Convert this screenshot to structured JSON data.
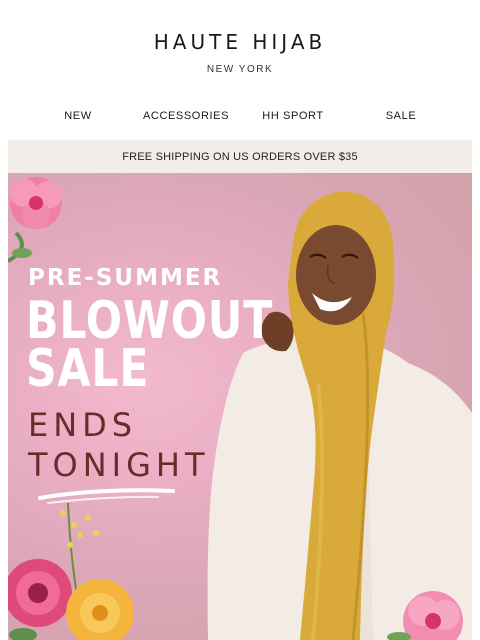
{
  "brand": {
    "name": "HAUTE HIJAB",
    "subtitle": "NEW YORK"
  },
  "nav": {
    "items": [
      {
        "label": "NEW"
      },
      {
        "label": "ACCESSORIES"
      },
      {
        "label": "HH SPORT"
      },
      {
        "label": "SALE"
      }
    ]
  },
  "banner": {
    "shipping": "FREE SHIPPING ON US ORDERS OVER $35"
  },
  "hero": {
    "pre": "PRE-SUMMER",
    "line1": "BLOWOUT",
    "line2": "SALE",
    "ends1": "ENDS",
    "ends2": "TONIGHT"
  },
  "colors": {
    "hijab": "#d9a93a",
    "sweater": "#f3ece4",
    "ends_text": "#6b2b2b",
    "ship_bar": "#f2ede8"
  }
}
